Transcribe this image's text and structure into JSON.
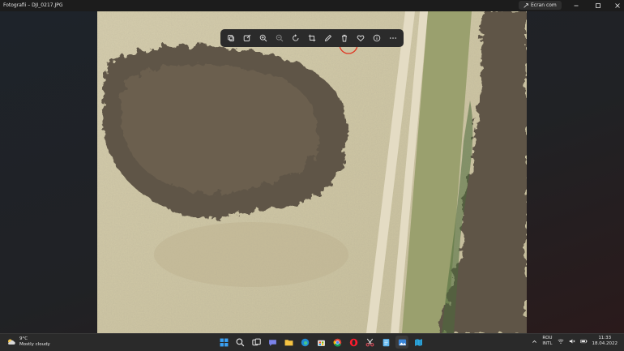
{
  "window": {
    "title": "Fotografii – DJI_0217.JPG",
    "fullscreen_label": "Ecran com"
  },
  "toolbar": {
    "items": [
      "duplicate-icon",
      "edit-image-icon",
      "zoom-in-icon",
      "zoom-out-icon",
      "rotate-icon",
      "crop-icon",
      "draw-icon",
      "delete-icon",
      "favorite-icon",
      "info-icon",
      "more-icon"
    ]
  },
  "taskbar": {
    "weather_temp": "9°C",
    "weather_desc": "Mostly cloudy",
    "lang_top": "ROU",
    "lang_bottom": "INTL",
    "time": "11:33",
    "date": "18.04.2022"
  },
  "colors": {
    "titlebar": "#1c1c1c",
    "toolbar": "#2b2b2b",
    "taskbar": "#2a2a2a",
    "grass": "#c9c19f",
    "strip": "#9aa06e",
    "shrub": "#5e5446"
  }
}
